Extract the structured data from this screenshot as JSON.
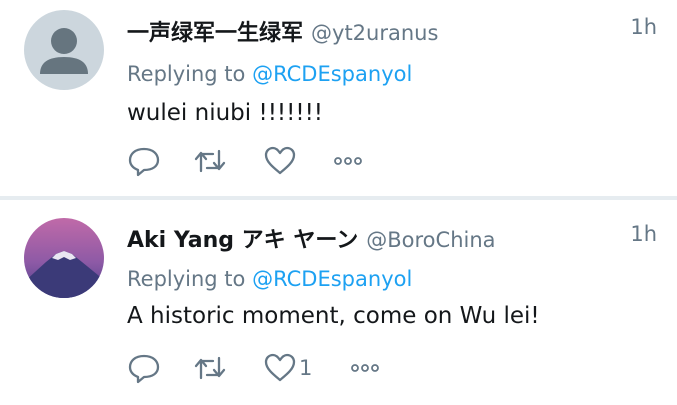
{
  "tweets": [
    {
      "name": "一声绿军一生绿军",
      "handle": "@yt2uranus",
      "time": "1h",
      "reply_prefix": "Replying to",
      "reply_to": "@RCDEspanyol",
      "text": "wulei niubi !!!!!!!",
      "likes": ""
    },
    {
      "name": "Aki Yang アキ ヤーン",
      "handle": "@BoroChina",
      "time": "1h",
      "reply_prefix": "Replying to",
      "reply_to": "@RCDEspanyol",
      "text": "A historic moment, come on Wu lei!",
      "likes": "1"
    }
  ],
  "icons": {
    "reply": "reply-icon",
    "retweet": "retweet-icon",
    "like": "heart-icon",
    "more": "more-icon"
  },
  "colors": {
    "link": "#1da1f2",
    "muted": "#657786",
    "text": "#14171a",
    "divider": "#e6ecf0"
  }
}
